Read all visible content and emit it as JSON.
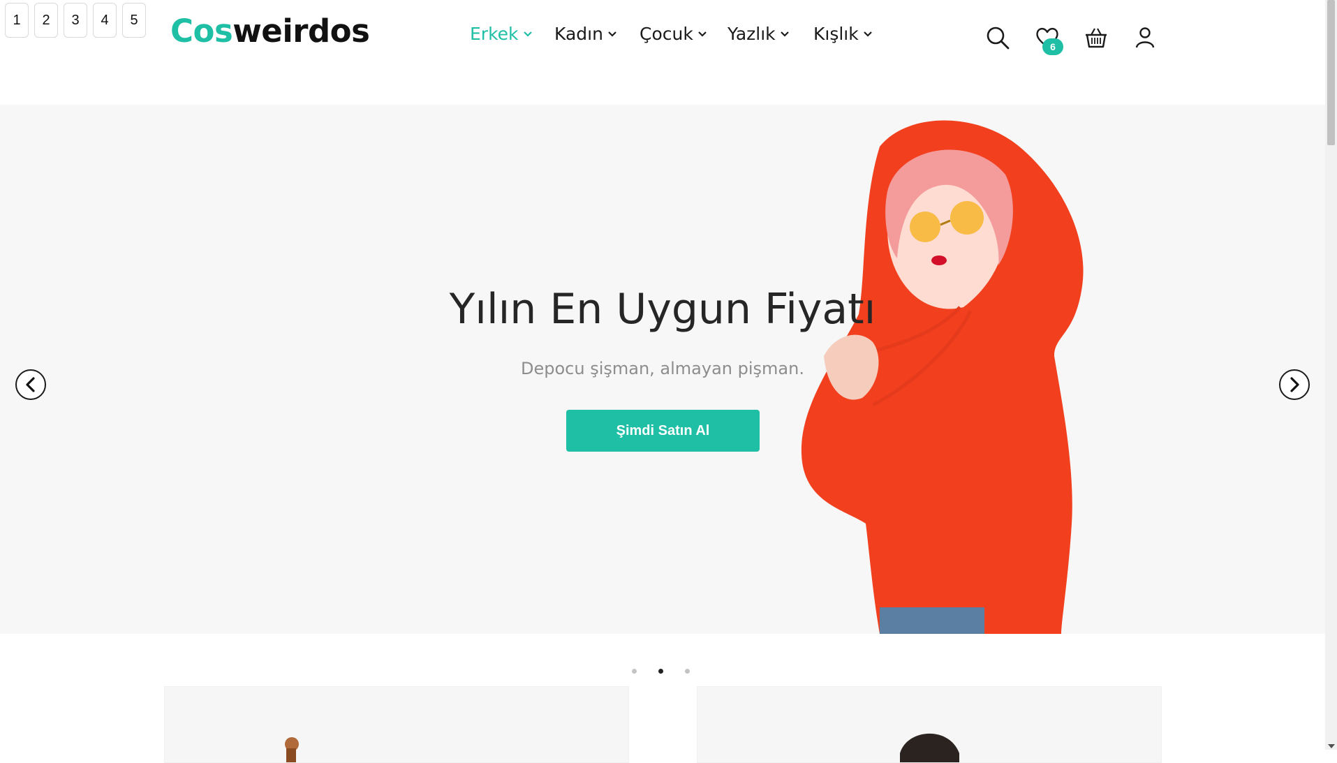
{
  "pager": [
    "1",
    "2",
    "3",
    "4",
    "5"
  ],
  "brand": {
    "part1": "Cos",
    "part2": "weirdos",
    "accent_color": "#1fbfa6"
  },
  "nav": [
    {
      "label": "Erkek",
      "active": true
    },
    {
      "label": "Kadın",
      "active": false
    },
    {
      "label": "Çocuk",
      "active": false
    },
    {
      "label": "Yazlık",
      "active": false
    },
    {
      "label": "Kışlık",
      "active": false
    }
  ],
  "header_icons": {
    "search": "search-icon",
    "wishlist": "heart-icon",
    "wishlist_count": "6",
    "cart": "basket-icon",
    "account": "user-icon"
  },
  "hero": {
    "title": "Yılın En Uygun Fiyatı",
    "subtitle": "Depocu şişman, almayan pişman.",
    "cta": "Şimdi Satın Al",
    "prev": "chevron-left-icon",
    "next": "chevron-right-icon",
    "slide_count": 3,
    "active_slide": 2
  }
}
